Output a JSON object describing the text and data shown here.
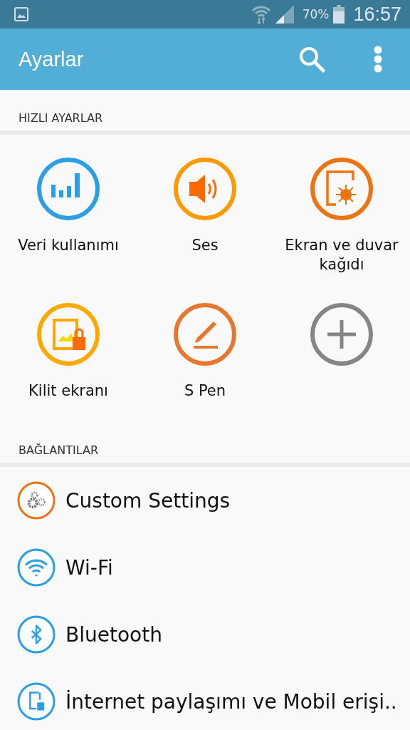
{
  "status_bar": {
    "battery": "70%",
    "time": "16:57"
  },
  "app_bar": {
    "title": "Ayarlar"
  },
  "quick_settings": {
    "header": "HIZLI AYARLAR",
    "items": [
      {
        "label": "Veri kullanımı",
        "kind": "data",
        "color": "#2a9fe6"
      },
      {
        "label": "Ses",
        "kind": "sound",
        "color": "#ff9900"
      },
      {
        "label": "Ekran ve duvar kağıdı",
        "kind": "display",
        "color": "#ee7411"
      },
      {
        "label": "Kilit ekranı",
        "kind": "lock",
        "color": "#ffa800"
      },
      {
        "label": "S Pen",
        "kind": "pen",
        "color": "#e8772e"
      },
      {
        "kind": "add",
        "color": "#858585"
      }
    ]
  },
  "connections": {
    "header": "BAĞLANTILAR",
    "items": [
      {
        "label": "Custom Settings",
        "kind": "gears",
        "color": "#f47216"
      },
      {
        "label": "Wi-Fi",
        "kind": "wifi",
        "color": "#2a9fe6"
      },
      {
        "label": "Bluetooth",
        "kind": "bluetooth",
        "color": "#2a9fe6"
      },
      {
        "label": "İnternet paylaşımı ve Mobil erişi..",
        "kind": "hotspot",
        "color": "#2a9fe6"
      }
    ]
  }
}
